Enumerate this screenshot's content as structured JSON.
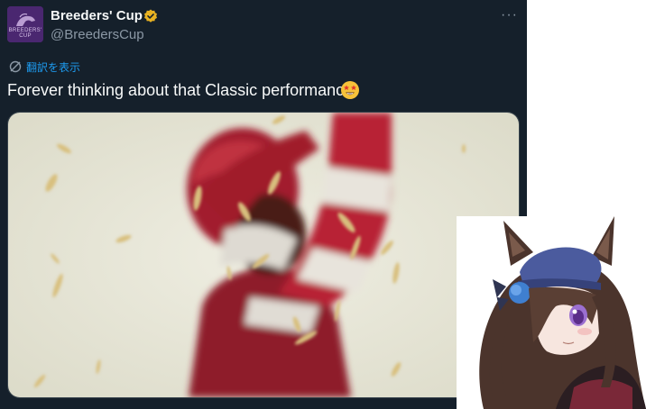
{
  "tweet": {
    "avatar_text": "BREEDERS' CUP",
    "display_name": "Breeders' Cup",
    "handle": "@BreedersCup",
    "more_label": "···",
    "translate_label": "翻訳を表示",
    "text": "Forever thinking about that Classic performance!",
    "emoji": "star-struck-emoji"
  },
  "colors": {
    "background": "#15202b",
    "link": "#1d9bf0",
    "secondary_text": "#8b98a5",
    "verified_badge": "#e8b222",
    "jockey_silks": "#9e1d2b"
  }
}
